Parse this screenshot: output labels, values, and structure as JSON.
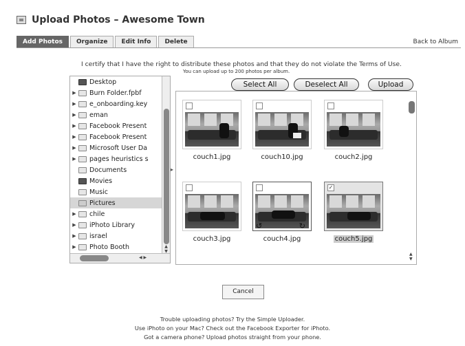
{
  "header": {
    "title": "Upload Photos – Awesome Town",
    "icon": "photo-album-icon"
  },
  "tabs": [
    {
      "label": "Add Photos",
      "active": true
    },
    {
      "label": "Organize"
    },
    {
      "label": "Edit Info"
    },
    {
      "label": "Delete"
    }
  ],
  "back_link": "Back to Album",
  "certify_text": "I certify that I have the right to distribute these photos and that they do not violate the Terms of Use.",
  "limit_text": "You can upload up to 200 photos per album.",
  "file_browser": {
    "items": [
      {
        "label": "Desktop",
        "icon": "desktop-icon",
        "expander": false
      },
      {
        "label": "Burn Folder.fpbf",
        "icon": "folder-icon",
        "expander": true
      },
      {
        "label": "e_onboarding.key",
        "icon": "folder-icon",
        "expander": true
      },
      {
        "label": "eman",
        "icon": "folder-icon",
        "expander": true
      },
      {
        "label": "Facebook Present",
        "icon": "folder-icon",
        "expander": true
      },
      {
        "label": "Facebook Present",
        "icon": "folder-icon",
        "expander": true
      },
      {
        "label": "Microsoft User Da",
        "icon": "folder-icon",
        "expander": true
      },
      {
        "label": "pages heuristics s",
        "icon": "folder-icon",
        "expander": true
      },
      {
        "label": "Documents",
        "icon": "documents-folder-icon",
        "expander": false
      },
      {
        "label": "Movies",
        "icon": "movies-folder-icon",
        "expander": false
      },
      {
        "label": "Music",
        "icon": "music-folder-icon",
        "expander": false
      },
      {
        "label": "Pictures",
        "icon": "pictures-folder-icon",
        "expander": false,
        "selected": true
      },
      {
        "label": "chile",
        "icon": "folder-icon",
        "expander": true
      },
      {
        "label": "iPhoto Library",
        "icon": "folder-icon",
        "expander": true
      },
      {
        "label": "israel",
        "icon": "folder-icon",
        "expander": true
      },
      {
        "label": "Photo Booth",
        "icon": "folder-icon",
        "expander": true
      }
    ]
  },
  "buttons": {
    "select_all": "Select All",
    "deselect_all": "Deselect All",
    "upload": "Upload",
    "cancel": "Cancel"
  },
  "photos": [
    {
      "name": "couch1.jpg",
      "checked": false
    },
    {
      "name": "couch10.jpg",
      "checked": false
    },
    {
      "name": "couch2.jpg",
      "checked": false
    },
    {
      "name": "couch3.jpg",
      "checked": false
    },
    {
      "name": "couch4.jpg",
      "checked": false,
      "hover": true
    },
    {
      "name": "couch5.jpg",
      "checked": true,
      "selected": true
    }
  ],
  "footer": {
    "line1": "Trouble uploading photos? Try the Simple Uploader.",
    "line2": "Use iPhoto on your Mac? Check out the Facebook Exporter for iPhoto.",
    "line3": "Got a camera phone? Upload photos straight from your phone."
  }
}
